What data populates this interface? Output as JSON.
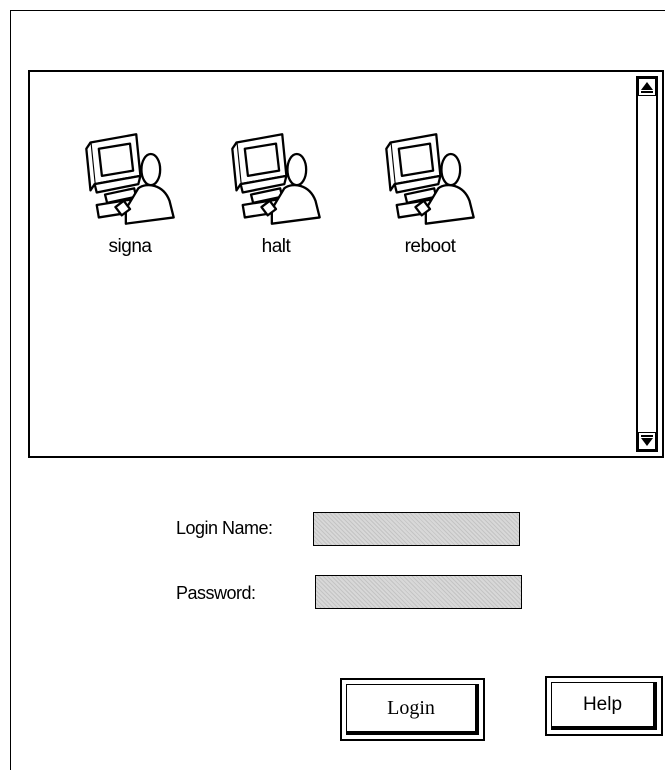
{
  "users": [
    {
      "name": "signa",
      "icon": "user-workstation-icon"
    },
    {
      "name": "halt",
      "icon": "user-workstation-icon"
    },
    {
      "name": "reboot",
      "icon": "user-workstation-icon"
    }
  ],
  "form": {
    "login_name_label": "Login Name:",
    "login_name_value": "",
    "password_label": "Password:",
    "password_value": ""
  },
  "buttons": {
    "login_label": "Login",
    "help_label": "Help"
  },
  "scrollbar": {
    "up_icon": "scroll-up-arrow-icon",
    "down_icon": "scroll-down-arrow-icon"
  }
}
